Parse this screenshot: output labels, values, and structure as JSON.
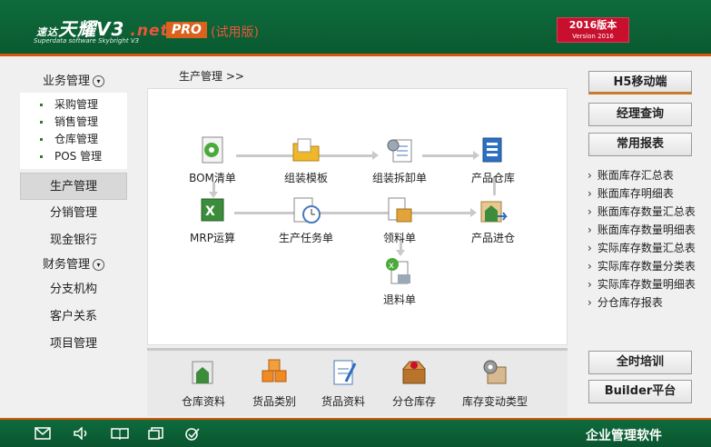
{
  "header": {
    "logo_prefix": "速达",
    "logo_name": "天耀V3",
    "logo_suffix": ".net",
    "logo_sub": "Superdata software Skybright V3",
    "pro": "PRO",
    "trial": "(试用版)",
    "version_main": "2016版本",
    "version_sub": "Version 2016"
  },
  "breadcrumb": "生产管理  >>",
  "left_nav": {
    "business_group": "业务管理",
    "business_items": [
      "采购管理",
      "销售管理",
      "仓库管理",
      "POS 管理"
    ],
    "items": [
      "生产管理",
      "分销管理",
      "现金银行"
    ],
    "finance_group": "财务管理",
    "items2": [
      "分支机构",
      "客户关系",
      "项目管理"
    ]
  },
  "flow": {
    "bom": "BOM清单",
    "assembly_template": "组装模板",
    "assembly_disassembly": "组装拆卸单",
    "product_warehouse": "产品仓库",
    "mrp": "MRP运算",
    "production_task": "生产任务单",
    "material_pick": "领料单",
    "product_in": "产品进仓",
    "material_return": "退料单"
  },
  "bottom": {
    "items": [
      "仓库资料",
      "货品类别",
      "货品资料",
      "分仓库存",
      "库存变动类型"
    ]
  },
  "right": {
    "h5": "H5移动端",
    "manager_query": "经理查询",
    "common_reports": "常用报表",
    "reports": [
      "账面库存汇总表",
      "账面库存明细表",
      "账面库存数量汇总表",
      "账面库存数量明细表",
      "实际库存数量汇总表",
      "实际库存数量分类表",
      "实际库存数量明细表",
      "分仓库存报表"
    ],
    "training": "全时培训",
    "builder": "Builder平台"
  },
  "footer": {
    "label": "企业管理软件"
  },
  "colors": {
    "header_green": "#0e6b3c",
    "accent_orange": "#d4570c",
    "version_red": "#c8102e"
  }
}
